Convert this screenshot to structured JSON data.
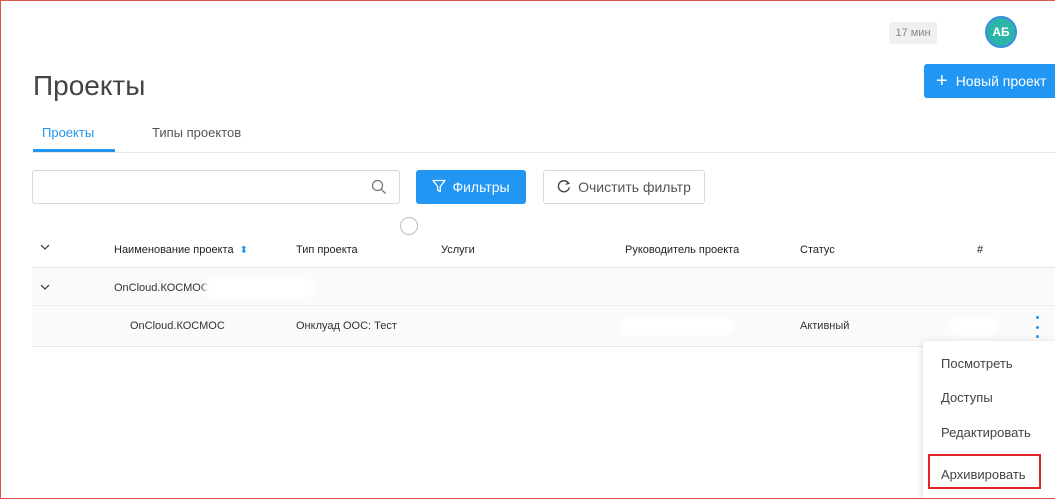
{
  "header": {
    "time": "17 мин",
    "avatar_initials": "АБ"
  },
  "page": {
    "title": "Проекты",
    "new_project_label": "Новый проект"
  },
  "tabs": [
    {
      "label": "Проекты",
      "active": true
    },
    {
      "label": "Типы проектов",
      "active": false
    }
  ],
  "toolbar": {
    "search_value": "",
    "filter_label": "Фильтры",
    "clear_label": "Очистить фильтр"
  },
  "table": {
    "headers": [
      "Наименование проекта",
      "Тип проекта",
      "Услуги",
      "Руководитель проекта",
      "Статус",
      "#"
    ],
    "group": {
      "name": "OnCloud.КОСМОС"
    },
    "rows": [
      {
        "name": "OnCloud.КОСМОС",
        "type": "Онклуад ООС: Тест",
        "services": "",
        "status": "Активный"
      }
    ]
  },
  "context_menu": {
    "items": [
      "Посмотреть",
      "Доступы",
      "Редактировать",
      "Архивировать"
    ],
    "highlighted": "Архивировать"
  },
  "colors": {
    "accent": "#2196f3",
    "highlight": "#e0242a",
    "avatar": "#2bb5a8"
  }
}
